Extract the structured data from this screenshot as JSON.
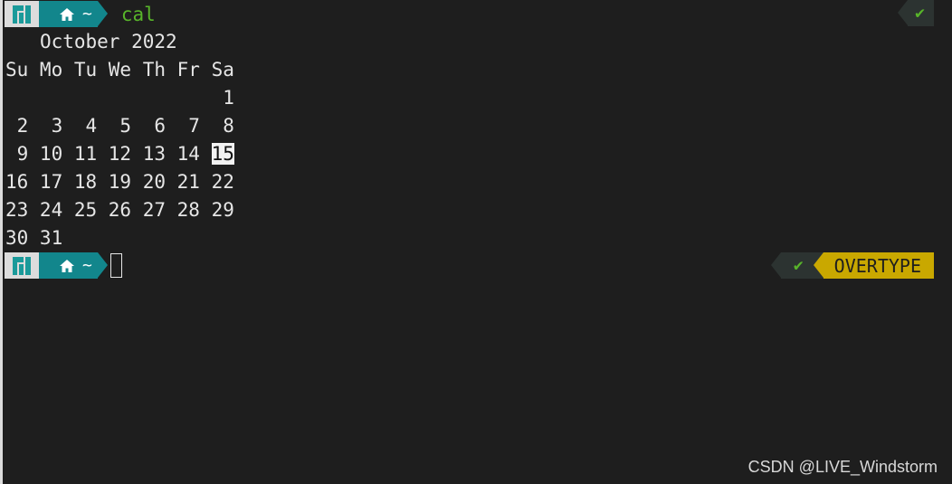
{
  "prompt": {
    "logo_icon": "manjaro-logo-icon",
    "home_icon": "home-icon",
    "dir": "~",
    "command": "cal"
  },
  "status": {
    "check": "✔",
    "mode": "OVERTYPE"
  },
  "calendar": {
    "month_year": "October 2022",
    "weekdays": "Su Mo Tu We Th Fr Sa",
    "rows": [
      "                   1",
      " 2  3  4  5  6  7  8",
      " 9 10 11 12 13 14 ",
      "16 17 18 19 20 21 22",
      "23 24 25 26 27 28 29",
      "30 31"
    ],
    "today": "15"
  },
  "watermark": "CSDN @LIVE_Windstorm",
  "colors": {
    "background": "#1e1e1e",
    "teal": "#12868c",
    "green": "#58b52a",
    "yellow": "#c9a800"
  }
}
